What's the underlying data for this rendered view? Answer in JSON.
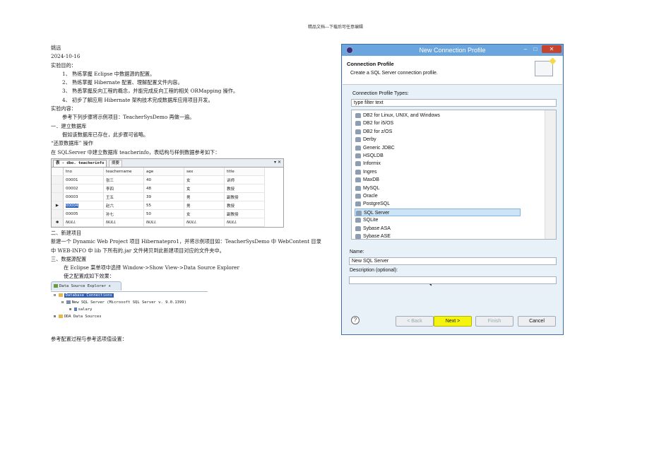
{
  "header": "精品文档---下载后可任意编辑",
  "doc": {
    "lines": [
      "姚远",
      "2024-10-16",
      "实验目的：",
      "1、 熟练掌握 Eclipse 中数据源的配置。",
      "2、 熟练掌握 Hibernate 配置、理解配置文件内容。",
      "3、 熟悉掌握反向工程的概念，并能完成反向工程的相关 ORMapping 操作。",
      "4、 初步了解应用 Hibernate 架构技术完成数据库应用项目开发。",
      "实验内容：",
      "参考下列步骤将示例项目：TeacherSysDemo 再做一遍。",
      "一．建立数据库",
      "假如该数据库已存在，此步骤可省略。",
      "“还原数据库” 操作",
      "在 SQLServer 中建立数据库 teacherinfo，表结构与样例数据参考如下："
    ],
    "lines2": [
      "二、新建项目",
      "新建一个 Dynamic Web Project 项目 Hibernatepro1，并将示例项目如：TeacherSysDemo 中 WebContent 目录",
      "中 WEB-INFO 中 lib 下所有的.jar 文件拷贝到此新建项目对应的文件夹中。",
      "三、数据源配置",
      "在 Eclipse 菜单项中选择 Window->Show View->Data Source Explorer",
      "使之配置成如下效果："
    ],
    "footer_line": "参考配置过程与参考选项值设置："
  },
  "table_shot": {
    "tab1": "表 - dbo. teacherinfo",
    "tab2": "摘要",
    "ctrl": "▾ ✕",
    "headers": [
      "tno",
      "teachername",
      "age",
      "sex",
      "title"
    ],
    "rows": [
      {
        "marker": "",
        "cells": [
          "00001",
          "张三",
          "40",
          "女",
          "讲师"
        ]
      },
      {
        "marker": "",
        "cells": [
          "00002",
          "李四",
          "48",
          "女",
          "教授"
        ]
      },
      {
        "marker": "",
        "cells": [
          "00003",
          "王五",
          "39",
          "男",
          "副教授"
        ]
      },
      {
        "marker": "▶",
        "cells": [
          "00004",
          "赵六",
          "55",
          "男",
          "教授"
        ]
      },
      {
        "marker": "",
        "cells": [
          "00005",
          "孙七",
          "50",
          "女",
          "副教授"
        ]
      },
      {
        "marker": "✱",
        "cells": [
          "NULL",
          "NULL",
          "NULL",
          "NULL",
          "NULL"
        ]
      }
    ]
  },
  "dse": {
    "tab": "Data Source Explorer",
    "nodes": [
      {
        "toggle": "⊟",
        "label": "Database Connections",
        "selected": true
      },
      {
        "toggle": "⊟",
        "label": "New SQL Server (Microsoft SQL Server v. 9.0.1399)",
        "selected": false
      },
      {
        "toggle": "⊞",
        "label": "salary",
        "selected": false
      },
      {
        "toggle": "⊞",
        "label": "ODA Data Sources",
        "selected": false
      }
    ]
  },
  "dialog": {
    "title": "New Connection Profile",
    "banner_title": "Connection Profile",
    "banner_desc": "Create a SQL Server connection profile.",
    "types_label": "Connection Profile Types:",
    "filter_value": "type filter text",
    "types": [
      "DB2 for Linux, UNIX, and Windows",
      "DB2 for i5/OS",
      "DB2 for z/OS",
      "Derby",
      "Generic JDBC",
      "HSQLDB",
      "Informix",
      "Ingres",
      "MaxDB",
      "MySQL",
      "Oracle",
      "PostgreSQL",
      "SQL Server",
      "SQLite",
      "Sybase ASA",
      "Sybase ASE"
    ],
    "selected_type": "SQL Server",
    "name_label": "Name:",
    "name_value": "New SQL Server",
    "desc_label": "Description (optional):",
    "desc_value": "",
    "buttons": {
      "help": "?",
      "back": "< Back",
      "next": "Next >",
      "finish": "Finish",
      "cancel": "Cancel"
    },
    "win": {
      "min": "–",
      "max": "□",
      "close": "✕"
    }
  },
  "colors": {
    "highlight": "#f4f40f",
    "titlebar": "#6ba5de",
    "selection": "#3568c0"
  }
}
